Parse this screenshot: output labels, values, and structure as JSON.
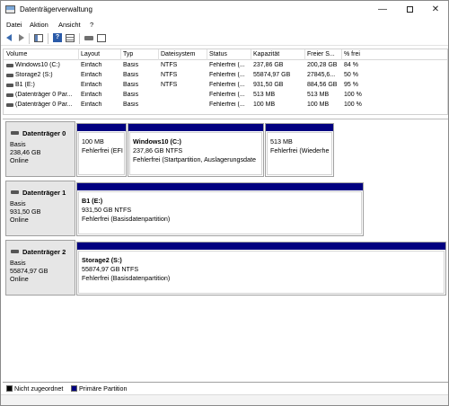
{
  "window": {
    "title": "Datenträgerverwaltung",
    "minimize": "—",
    "close": "✕"
  },
  "menu": [
    "Datei",
    "Aktion",
    "Ansicht",
    "?"
  ],
  "toolbar_icons": [
    "back-arrow-icon",
    "forward-arrow-icon",
    "console-tree-icon",
    "help-icon",
    "list-view-icon",
    "disk-icon",
    "properties-icon"
  ],
  "table": {
    "headers": [
      "Volume",
      "Layout",
      "Typ",
      "Dateisystem",
      "Status",
      "Kapazität",
      "Freier S...",
      "% frei"
    ],
    "rows": [
      [
        "Windows10 (C:)",
        "Einfach",
        "Basis",
        "NTFS",
        "Fehlerfrei (...",
        "237,86 GB",
        "200,28 GB",
        "84 %"
      ],
      [
        "Storage2 (S:)",
        "Einfach",
        "Basis",
        "NTFS",
        "Fehlerfrei (...",
        "55874,97 GB",
        "27845,6...",
        "50 %"
      ],
      [
        "B1 (E:)",
        "Einfach",
        "Basis",
        "NTFS",
        "Fehlerfrei (...",
        "931,50 GB",
        "884,56 GB",
        "95 %"
      ],
      [
        "(Datenträger 0 Par...",
        "Einfach",
        "Basis",
        "",
        "Fehlerfrei (...",
        "513 MB",
        "513 MB",
        "100 %"
      ],
      [
        "(Datenträger 0 Par...",
        "Einfach",
        "Basis",
        "",
        "Fehlerfrei (...",
        "100 MB",
        "100 MB",
        "100 %"
      ]
    ]
  },
  "disks": [
    {
      "name": "Datenträger 0",
      "type": "Basis",
      "size": "238,46 GB",
      "status": "Online",
      "partitions": [
        {
          "name": "",
          "size": "100 MB",
          "status": "Fehlerfrei (EFI"
        },
        {
          "name": "Windows10  (C:)",
          "size": "237,86 GB NTFS",
          "status": "Fehlerfrei (Startpartition, Auslagerungsdate"
        },
        {
          "name": "",
          "size": "513 MB",
          "status": "Fehlerfrei (Wiederhe"
        }
      ]
    },
    {
      "name": "Datenträger 1",
      "type": "Basis",
      "size": "931,50 GB",
      "status": "Online",
      "partitions": [
        {
          "name": "B1  (E:)",
          "size": "931,50 GB NTFS",
          "status": "Fehlerfrei (Basisdatenpartition)"
        }
      ]
    },
    {
      "name": "Datenträger 2",
      "type": "Basis",
      "size": "55874,97 GB",
      "status": "Online",
      "partitions": [
        {
          "name": "Storage2  (S:)",
          "size": "55874,97 GB NTFS",
          "status": "Fehlerfrei (Basisdatenpartition)"
        }
      ]
    }
  ],
  "legend": {
    "unallocated": {
      "label": "Nicht zugeordnet",
      "color": "#000000"
    },
    "primary": {
      "label": "Primäre Partition",
      "color": "#010080"
    }
  }
}
